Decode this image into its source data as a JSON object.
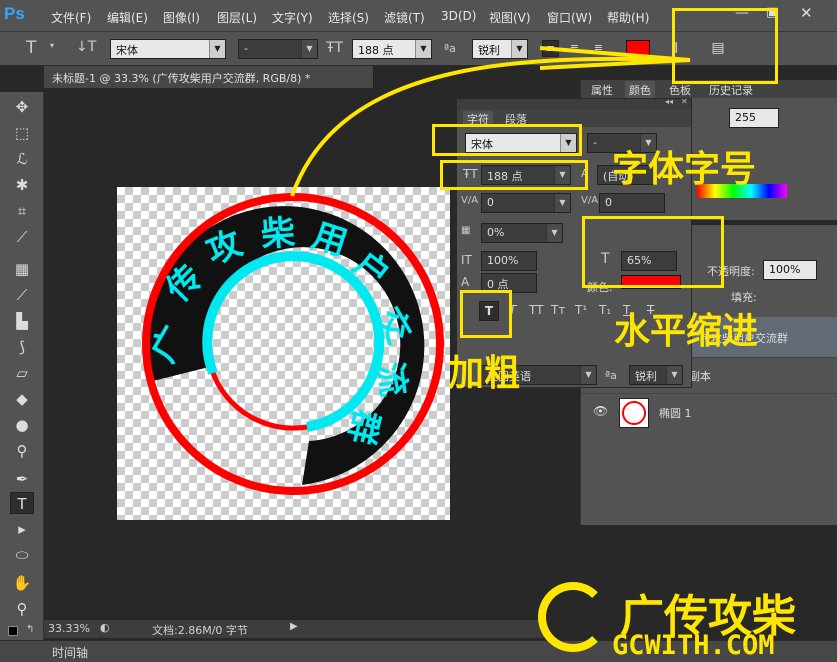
{
  "app": {
    "logo": "Ps"
  },
  "menu": [
    "文件(F)",
    "编辑(E)",
    "图像(I)",
    "图层(L)",
    "文字(Y)",
    "选择(S)",
    "滤镜(T)",
    "3D(D)",
    "视图(V)",
    "窗口(W)",
    "帮助(H)"
  ],
  "options_bar": {
    "font_family": "宋体",
    "font_style": "-",
    "font_size": "188 点",
    "aa_label": "ªa",
    "antialias": "锐利",
    "text_color": "#ff0000"
  },
  "document_tab": {
    "title": "未标题-1 @ 33.3% (广传攻柴用户交流群, RGB/8) *"
  },
  "status_bar": {
    "zoom": "33.33%",
    "doc_info": "文档:2.86M/0 字节"
  },
  "timeline_tab": "时间轴",
  "character_panel": {
    "tabs": [
      "字符",
      "段落"
    ],
    "font_family": "宋体",
    "font_style": "-",
    "font_size": "188 点",
    "leading": "(自动)",
    "kerning": "0",
    "tracking": "0",
    "tsume": "0%",
    "vertical_scale": "100%",
    "horizontal_scale": "65%",
    "baseline_shift": "0 点",
    "color_label": "颜色:",
    "color": "#ff0000",
    "language": "美国英语",
    "antialias": "锐利",
    "style_buttons": [
      "T",
      "T",
      "TT",
      "Tт",
      "T¹",
      "T₁",
      "T",
      "T"
    ]
  },
  "right_panels": {
    "tabs": [
      "属性",
      "颜色",
      "色板",
      "历史记录"
    ],
    "color_value": "255",
    "opacity_label": "不透明度:",
    "opacity": "100%",
    "fill_label": "填充:",
    "layers": [
      {
        "name": "广传攻柴用户交流群"
      },
      {
        "name": "副本"
      },
      {
        "name": "椭圆 1"
      }
    ]
  },
  "annotations": {
    "font_label": "字体字号",
    "scale_label": "水平缩进",
    "bold_label": "加粗",
    "watermark_cn": "广传攻柴",
    "watermark_en": "GCWITH.COM"
  },
  "canvas_text": "广传攻柴用户交流群",
  "colors": {
    "yellow": "#ffe600",
    "cyan": "#00e8f0",
    "red": "#ff0000"
  }
}
